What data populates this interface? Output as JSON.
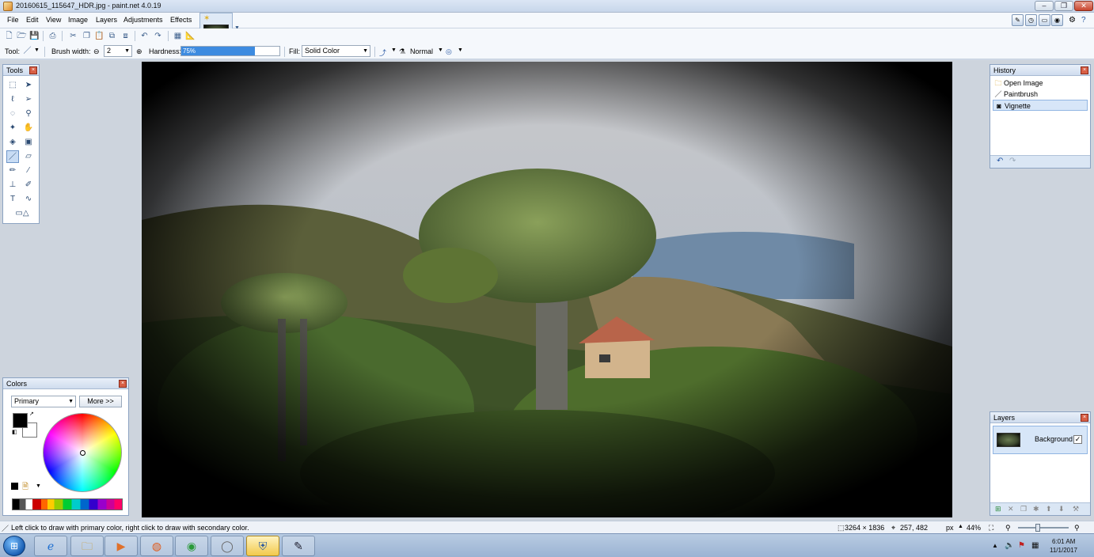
{
  "window": {
    "title": "20160615_115647_HDR.jpg - paint.net 4.0.19",
    "buttons": [
      "–",
      "❐",
      "✕"
    ]
  },
  "menu": [
    "File",
    "Edit",
    "View",
    "Image",
    "Layers",
    "Adjustments",
    "Effects"
  ],
  "toolbar": {
    "tool_label": "Tool:",
    "brush_width_label": "Brush width:",
    "brush_width_value": "2",
    "hardness_label": "Hardness:",
    "hardness_value": "75%",
    "hardness_fraction": 0.75,
    "fill_label": "Fill:",
    "fill_value": "Solid Color",
    "blend_value": "Normal"
  },
  "panels": {
    "tools": {
      "title": "Tools"
    },
    "history": {
      "title": "History",
      "items": [
        {
          "label": "Open Image",
          "icon": "folder-icon"
        },
        {
          "label": "Paintbrush",
          "icon": "paintbrush-icon"
        },
        {
          "label": "Vignette",
          "icon": "vignette-icon"
        }
      ],
      "selected_index": 2
    },
    "colors": {
      "title": "Colors",
      "mode_value": "Primary",
      "more_button": "More >>",
      "primary_color": "#000000",
      "secondary_color": "#ffffff"
    },
    "layers": {
      "title": "Layers",
      "layer_name": "Background",
      "visible_check": "✓"
    }
  },
  "status": {
    "hint": "Left click to draw with primary color, right click to draw with secondary color.",
    "image_size": "3264 × 1836",
    "cursor_pos": "257, 482",
    "unit": "px",
    "zoom": "44%"
  },
  "taskbar": {
    "time": "6:01 AM",
    "date": "11/1/2017"
  }
}
